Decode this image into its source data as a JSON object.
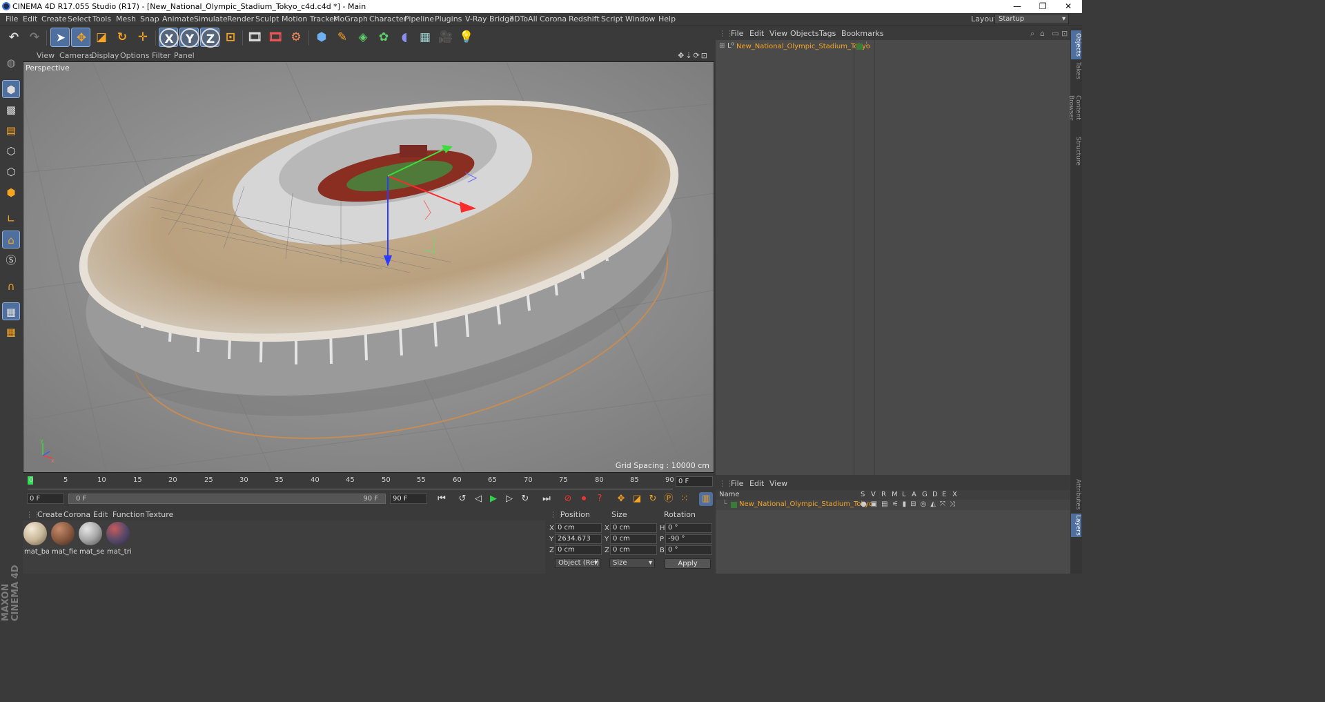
{
  "window": {
    "title": "CINEMA 4D R17.055 Studio (R17) - [New_National_Olympic_Stadium_Tokyo_c4d.c4d *] - Main",
    "minimize": "—",
    "restore": "❐",
    "close": "✕"
  },
  "menubar": {
    "items": [
      "File",
      "Edit",
      "Create",
      "Select",
      "Tools",
      "Mesh",
      "Snap",
      "Animate",
      "Simulate",
      "Render",
      "Sculpt",
      "Motion Tracker",
      "MoGraph",
      "Character",
      "Pipeline",
      "Plugins",
      "V-Ray Bridge",
      "3DToAll",
      "Corona",
      "Redshift",
      "Script",
      "Window",
      "Help"
    ],
    "layout_label": "Layout:",
    "layout_value": "Startup"
  },
  "toolbar": {
    "icons": [
      "undo-icon",
      "redo-icon",
      "live-selection-icon",
      "move-icon",
      "scale-icon",
      "rotate-icon",
      "recent-tool-icon",
      "x-axis-icon",
      "y-axis-icon",
      "z-axis-icon",
      "coordinate-system-icon",
      "render-view-icon",
      "render-picture-viewer-icon",
      "edit-render-settings-icon",
      "cube-icon",
      "pen-spline-icon",
      "subdivision-icon",
      "cloner-icon",
      "deformer-icon",
      "floor-icon",
      "camera-icon",
      "light-icon"
    ],
    "x_label": "X",
    "y_label": "Y",
    "z_label": "Z"
  },
  "viewport": {
    "menu": [
      "View",
      "Cameras",
      "Display",
      "Options",
      "Filter",
      "Panel"
    ],
    "label": "Perspective",
    "grid_spacing": "Grid Spacing : 10000 cm"
  },
  "objects_panel": {
    "menu": [
      "File",
      "Edit",
      "View",
      "Objects",
      "Tags",
      "Bookmarks"
    ],
    "object_name": "New_National_Olympic_Stadium_Tokyo"
  },
  "right_tabs": [
    "Objects",
    "Takes",
    "Content Browser",
    "Structure",
    "Attributes",
    "Layers"
  ],
  "timeline": {
    "ticks": [
      "0",
      "5",
      "10",
      "15",
      "20",
      "25",
      "30",
      "35",
      "40",
      "45",
      "50",
      "55",
      "60",
      "65",
      "70",
      "75",
      "80",
      "85",
      "90"
    ],
    "current_frame": "0 F",
    "start_field": "0 F",
    "slider_start": "0 F",
    "slider_end": "90 F",
    "end_field": "90 F"
  },
  "materials": {
    "menu": [
      "Create",
      "Corona",
      "Edit",
      "Function",
      "Texture"
    ],
    "items": [
      {
        "label": "mat_bas",
        "color": "#c9b89a"
      },
      {
        "label": "mat_fiel",
        "color": "#8a5a40"
      },
      {
        "label": "mat_sea",
        "color": "#a8a8a8"
      },
      {
        "label": "mat_trib",
        "color": "#5a4a6a"
      }
    ]
  },
  "coordinates": {
    "headers": {
      "position": "Position",
      "size": "Size",
      "rotation": "Rotation"
    },
    "rows": [
      {
        "axis": "X",
        "pos": "0 cm",
        "size_axis": "X",
        "size": "0 cm",
        "rot_axis": "H",
        "rot": "0 °"
      },
      {
        "axis": "Y",
        "pos": "2634.673 cm",
        "size_axis": "Y",
        "size": "0 cm",
        "rot_axis": "P",
        "rot": "-90 °"
      },
      {
        "axis": "Z",
        "pos": "0 cm",
        "size_axis": "Z",
        "size": "0 cm",
        "rot_axis": "B",
        "rot": "0 °"
      }
    ],
    "mode": "Object (Rel)",
    "size_mode": "Size",
    "apply": "Apply"
  },
  "layers_panel": {
    "menu": [
      "File",
      "Edit",
      "View"
    ],
    "columns": [
      "Name",
      "S",
      "V",
      "R",
      "M",
      "L",
      "A",
      "G",
      "D",
      "E",
      "X"
    ],
    "layer_name": "New_National_Olympic_Stadium_Tokyo"
  },
  "branding": "MAXON CINEMA 4D",
  "colors": {
    "accent": "#4f6f9e",
    "orange": "#f6a423",
    "panel": "#4a4a4a",
    "bg": "#3a3a3a"
  }
}
